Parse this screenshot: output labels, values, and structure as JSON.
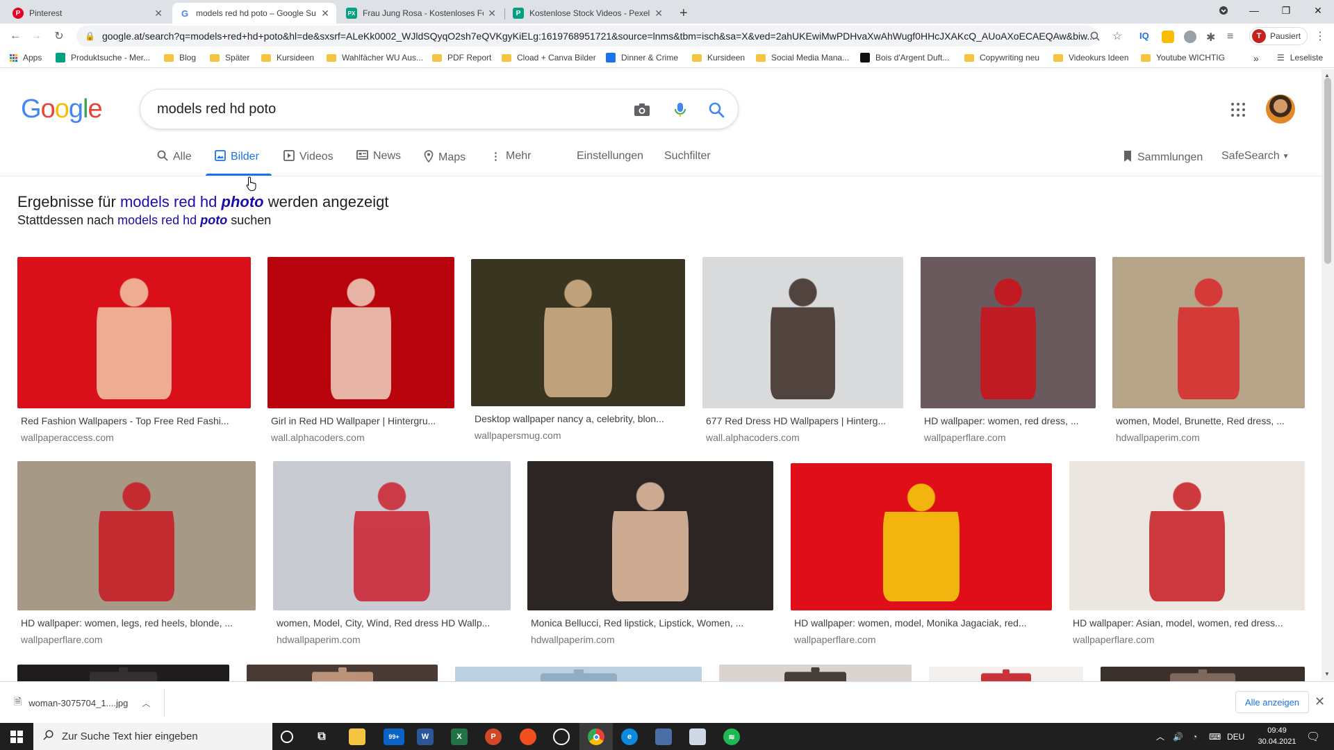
{
  "browser": {
    "tabs": [
      {
        "title": "Pinterest",
        "favicon_color": "#e60023",
        "favicon_letter": "P",
        "active": false
      },
      {
        "title": "models red hd poto – Google Su",
        "favicon_color": "#ffffff",
        "favicon_letter": "G",
        "active": true
      },
      {
        "title": "Frau Jung Rosa - Kostenloses Fo",
        "favicon_color": "#05a081",
        "favicon_letter": "PX",
        "active": false
      },
      {
        "title": "Kostenlose Stock Videos - Pexels",
        "favicon_color": "#05a081",
        "favicon_letter": "P",
        "active": false
      }
    ],
    "new_tab_symbol": "+",
    "url": "google.at/search?q=models+red+hd+poto&hl=de&sxsrf=ALeKk0002_WJldSQyqO2sh7eQVKgyKiELg:1619768951721&source=lnms&tbm=isch&sa=X&ved=2ahUKEwiMwPDHvaXwAhWugf0HHcJXAKcQ_AUoAXoECAEQAw&biw...",
    "profile_initial": "T",
    "profile_label": "Pausiert"
  },
  "bookmarks": {
    "apps": "Apps",
    "items": [
      {
        "label": "Produktsuche - Mer...",
        "type": "site",
        "color": "#00a082"
      },
      {
        "label": "Blog",
        "type": "folder"
      },
      {
        "label": "Später",
        "type": "folder"
      },
      {
        "label": "Kursideen",
        "type": "folder"
      },
      {
        "label": "Wahlfächer WU Aus...",
        "type": "folder"
      },
      {
        "label": "PDF Report",
        "type": "folder"
      },
      {
        "label": "Cload + Canva Bilder",
        "type": "folder"
      },
      {
        "label": "Dinner & Crime",
        "type": "site",
        "color": "#1a73e8"
      },
      {
        "label": "Kursideen",
        "type": "folder"
      },
      {
        "label": "Social Media Mana...",
        "type": "folder"
      },
      {
        "label": "Bois d'Argent Duft...",
        "type": "site",
        "color": "#111111"
      },
      {
        "label": "Copywriting neu",
        "type": "folder"
      },
      {
        "label": "Videokurs Ideen",
        "type": "folder"
      },
      {
        "label": "Youtube WICHTIG",
        "type": "folder"
      }
    ],
    "more": "»",
    "reading_list": "Leseliste"
  },
  "google": {
    "logo_letters": [
      {
        "ch": "G",
        "color": "#4285f4"
      },
      {
        "ch": "o",
        "color": "#ea4335"
      },
      {
        "ch": "o",
        "color": "#fbbc05"
      },
      {
        "ch": "g",
        "color": "#4285f4"
      },
      {
        "ch": "l",
        "color": "#34a853"
      },
      {
        "ch": "e",
        "color": "#ea4335"
      }
    ],
    "query": "models red hd poto"
  },
  "nav": {
    "tabs": [
      {
        "label": "Alle",
        "icon": "search-icon",
        "selected": false
      },
      {
        "label": "Bilder",
        "icon": "image-icon",
        "selected": true
      },
      {
        "label": "Videos",
        "icon": "play-icon",
        "selected": false
      },
      {
        "label": "News",
        "icon": "news-icon",
        "selected": false
      },
      {
        "label": "Maps",
        "icon": "pin-icon",
        "selected": false
      },
      {
        "label": "Mehr",
        "icon": "more-vert-icon",
        "selected": false
      }
    ],
    "settings": "Einstellungen",
    "filters": "Suchfilter",
    "collections": "Sammlungen",
    "safesearch": "SafeSearch"
  },
  "correction": {
    "prefix": "Ergebnisse für",
    "corrected_plain": "models red hd",
    "corrected_bold": "photo",
    "suffix": "werden angezeigt",
    "instead_prefix": "Stattdessen nach",
    "original_plain": "models red hd",
    "original_bold": "poto",
    "instead_suffix": "suchen"
  },
  "results": [
    {
      "caption": "Red Fashion Wallpapers - Top Free Red Fashi...",
      "source": "wallpaperaccess.com",
      "bg": "#d90f1a",
      "fg": "#f2c8a8"
    },
    {
      "caption": "Girl in Red HD Wallpaper | Hintergru...",
      "source": "wall.alphacoders.com",
      "bg": "#b8030d",
      "fg": "#f0d2c0"
    },
    {
      "caption": "Desktop wallpaper nancy a, celebrity, blon...",
      "source": "wallpapersmug.com",
      "bg": "#3a3520",
      "fg": "#d7b48c"
    },
    {
      "caption": "677 Red Dress HD Wallpapers | Hinterg...",
      "source": "wall.alphacoders.com",
      "bg": "#d9dadb",
      "fg": "#3a2a24"
    },
    {
      "caption": "HD wallpaper: women, red dress, ...",
      "source": "wallpaperflare.com",
      "bg": "#6a5a5e",
      "fg": "#d01018"
    },
    {
      "caption": "women, Model, Brunette, Red dress, ...",
      "source": "hdwallpaperim.com",
      "bg": "#b7a58a",
      "fg": "#d8282a"
    },
    {
      "caption": "HD wallpaper: women, legs, red heels, blonde, ...",
      "source": "wallpaperflare.com",
      "bg": "#a69a86",
      "fg": "#c81822"
    },
    {
      "caption": "women, Model, City, Wind, Red dress HD Wallp...",
      "source": "hdwallpaperim.com",
      "bg": "#c8ccd2",
      "fg": "#cc2030"
    },
    {
      "caption": "Monica Bellucci, Red lipstick, Lipstick, Women, ...",
      "source": "hdwallpaperim.com",
      "bg": "#2b2524",
      "fg": "#e9c2a6"
    },
    {
      "caption": "HD wallpaper: women, model, Monika Jagaciak, red...",
      "source": "wallpaperflare.com",
      "bg": "#e00e18",
      "fg": "#f5d30f"
    },
    {
      "caption": "HD wallpaper: Asian, model, women, red dress...",
      "source": "wallpaperflare.com",
      "bg": "#ebe6e0",
      "fg": "#c71a22"
    },
    {
      "caption": "",
      "source": "",
      "bg": "#1e1c1c",
      "fg": "#3a3433"
    },
    {
      "caption": "",
      "source": "",
      "bg": "#4a3a34",
      "fg": "#cfa384"
    },
    {
      "caption": "",
      "source": "",
      "bg": "#bdd0e2",
      "fg": "#8aa6c0"
    },
    {
      "caption": "",
      "source": "",
      "bg": "#d9d4cf",
      "fg": "#2d2420"
    },
    {
      "caption": "",
      "source": "",
      "bg": "#f3efed",
      "fg": "#c0121a"
    },
    {
      "caption": "",
      "source": "",
      "bg": "#3a302c",
      "fg": "#8c7468"
    }
  ],
  "download": {
    "filename": "woman-3075704_1....jpg",
    "show_all": "Alle anzeigen"
  },
  "taskbar": {
    "search_placeholder": "Zur Suche Text hier eingeben",
    "mail_badge": "99+",
    "lang": "DEU",
    "time": "09:49",
    "date": "30.04.2021"
  }
}
